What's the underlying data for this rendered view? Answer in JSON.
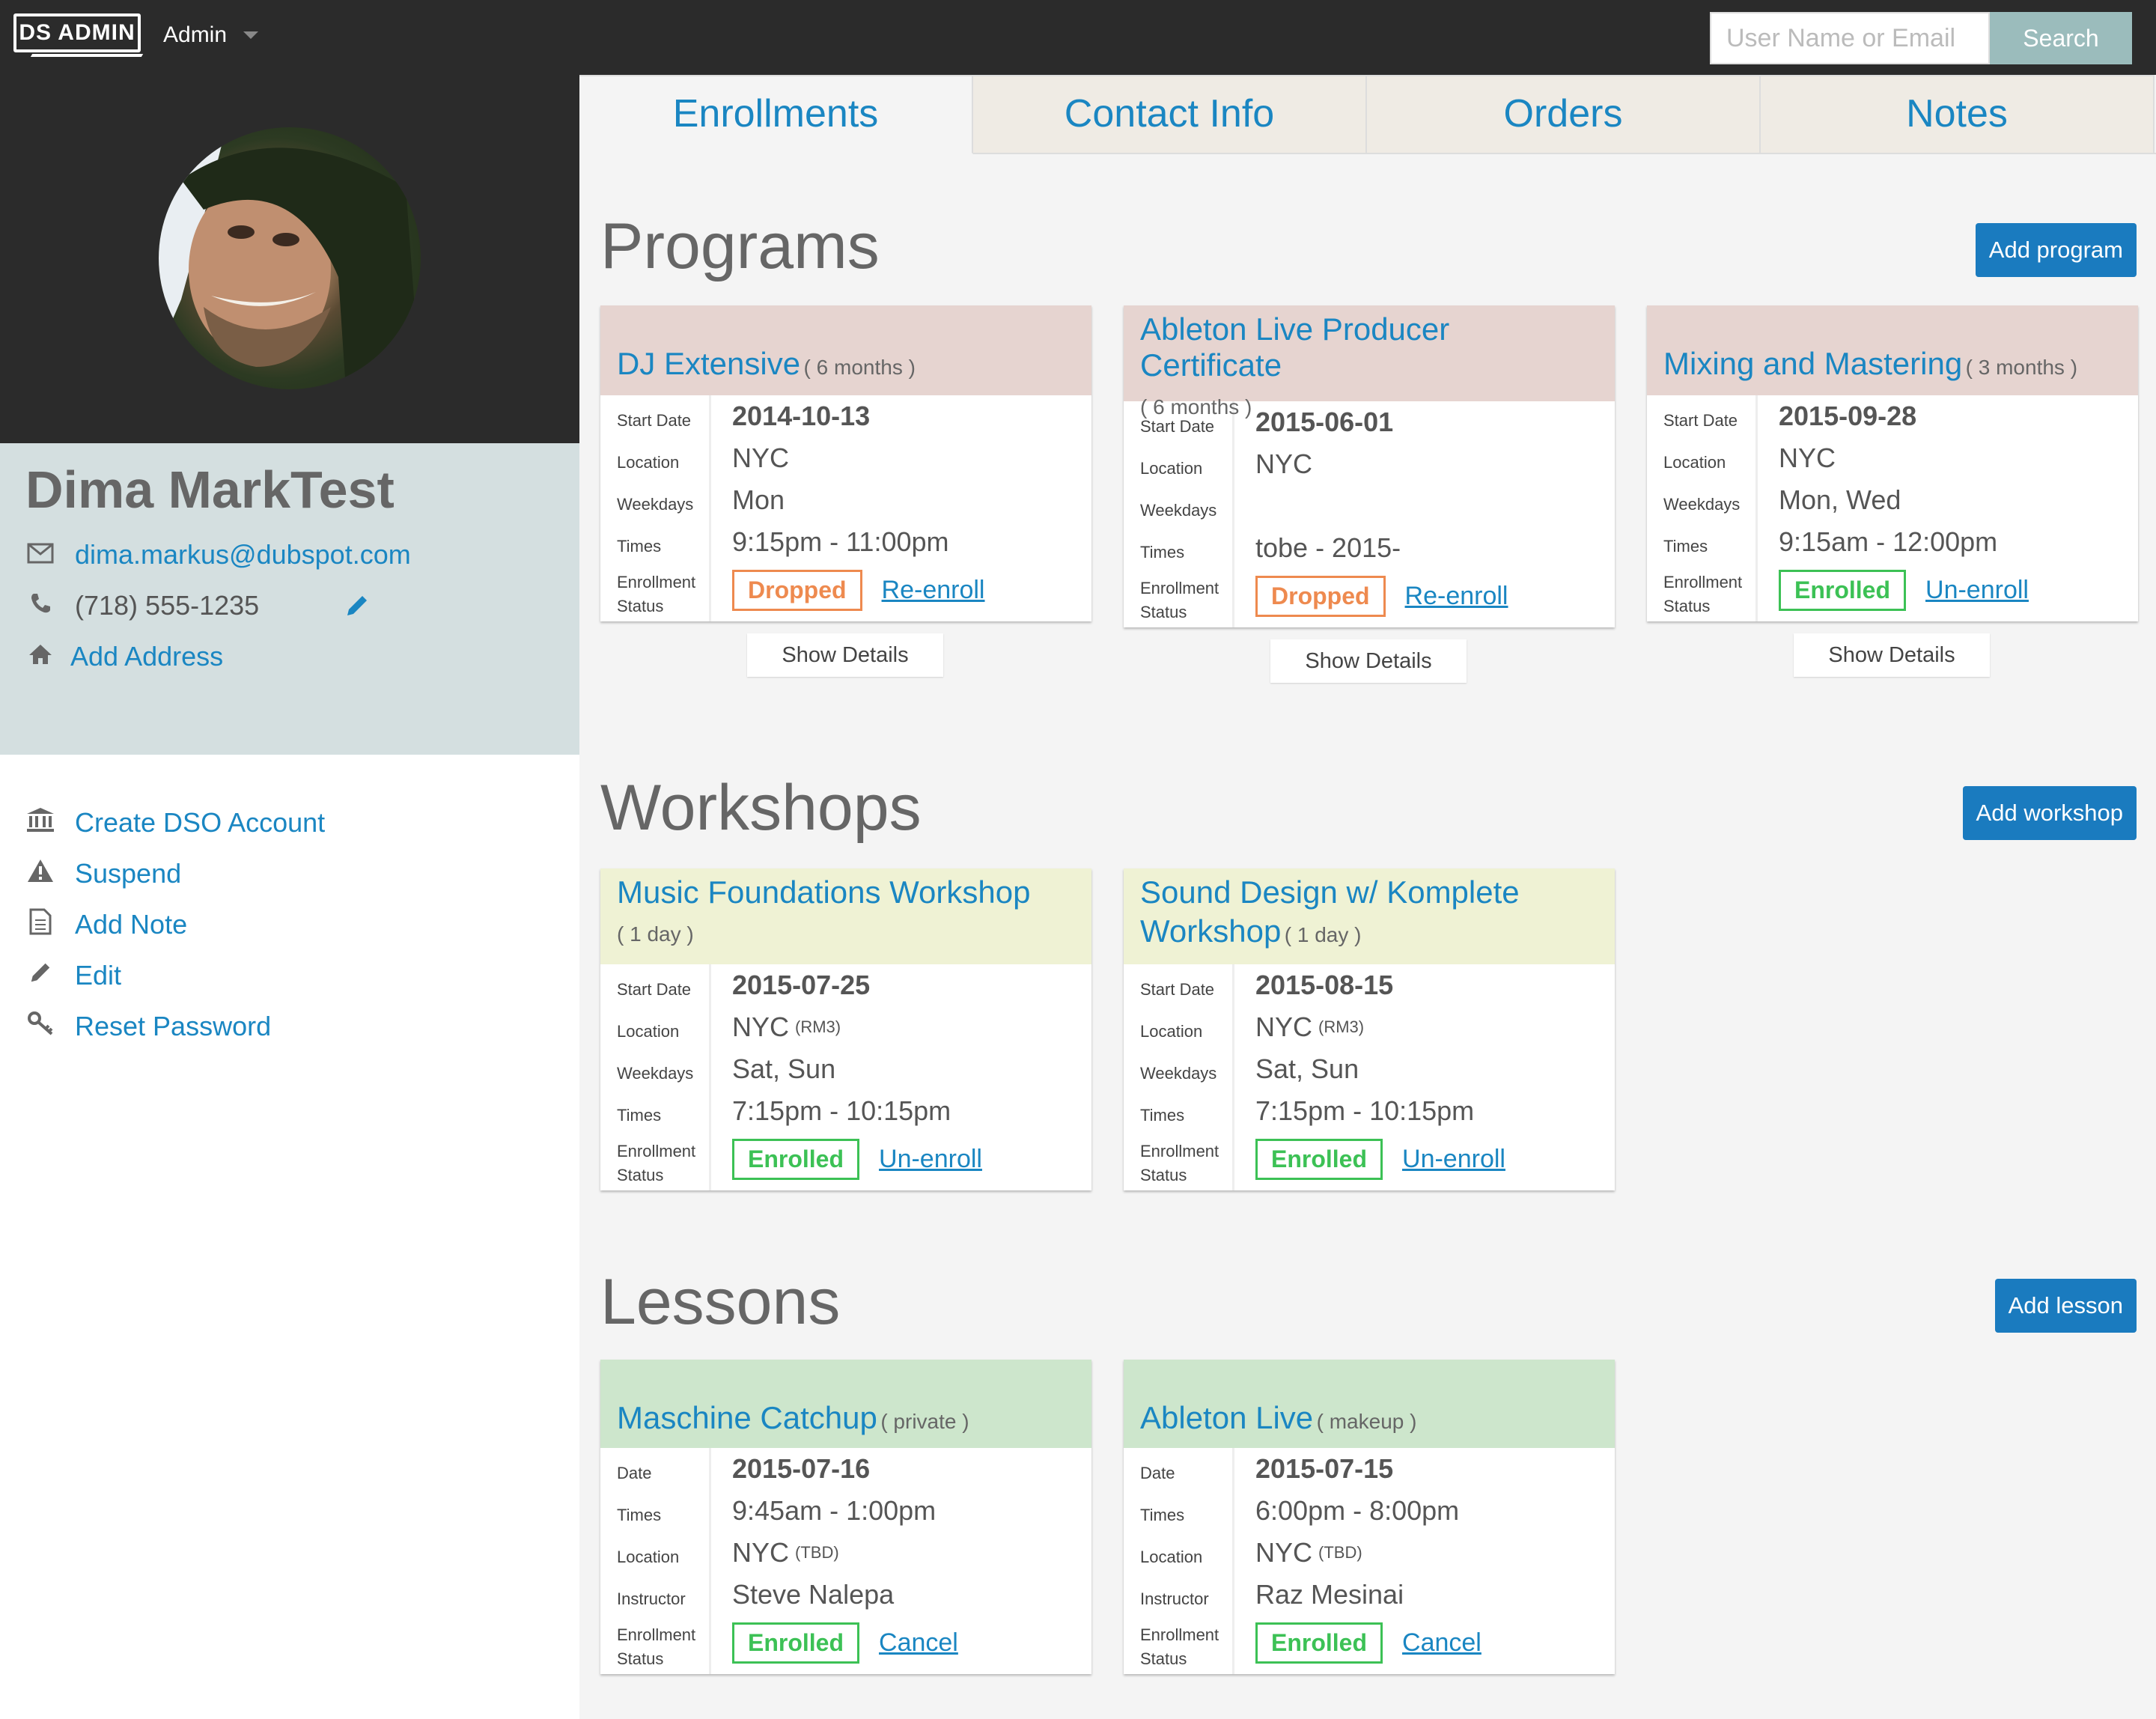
{
  "topbar": {
    "logo": "DS ADMIN",
    "admin_label": "Admin",
    "search_placeholder": "User Name or Email",
    "search_label": "Search"
  },
  "sidebar": {
    "user_name": "Dima MarkTest",
    "email": "dima.markus@dubspot.com",
    "phone": "(718) 555-1235",
    "add_address": "Add Address",
    "actions": {
      "create_dso": "Create DSO Account",
      "suspend": "Suspend",
      "add_note": "Add Note",
      "edit": "Edit",
      "reset_password": "Reset Password"
    }
  },
  "tabs": [
    "Enrollments",
    "Contact Info",
    "Orders",
    "Notes"
  ],
  "labels": {
    "start_date": "Start Date",
    "date": "Date",
    "location": "Location",
    "weekdays": "Weekdays",
    "times": "Times",
    "instructor": "Instructor",
    "enrollment": "Enrollment",
    "status": "Status",
    "show_details": "Show Details"
  },
  "programs": {
    "title": "Programs",
    "add_label": "Add program",
    "cards": [
      {
        "name": "DJ Extensive",
        "duration": "( 6 months )",
        "start_date": "2014-10-13",
        "location": "NYC",
        "weekdays": "Mon",
        "times": "9:15pm - 11:00pm",
        "status": "Dropped",
        "action": "Re-enroll"
      },
      {
        "name": "Ableton Live Producer Certificate",
        "duration": "( 6 months )",
        "start_date": "2015-06-01",
        "location": "NYC",
        "weekdays": "",
        "times": "tobe - 2015-",
        "status": "Dropped",
        "action": "Re-enroll"
      },
      {
        "name": "Mixing and Mastering",
        "duration": "( 3 months )",
        "start_date": "2015-09-28",
        "location": "NYC",
        "weekdays": "Mon, Wed",
        "times": "9:15am - 12:00pm",
        "status": "Enrolled",
        "action": "Un-enroll"
      }
    ]
  },
  "workshops": {
    "title": "Workshops",
    "add_label": "Add workshop",
    "cards": [
      {
        "name": "Music Foundations Workshop",
        "duration": "( 1 day )",
        "start_date": "2015-07-25",
        "location": "NYC",
        "room": "(RM3)",
        "weekdays": "Sat, Sun",
        "times": "7:15pm - 10:15pm",
        "status": "Enrolled",
        "action": "Un-enroll"
      },
      {
        "name_line1": "Sound Design w/ Komplete",
        "name_line2": "Workshop",
        "duration": "( 1 day )",
        "start_date": "2015-08-15",
        "location": "NYC",
        "room": "(RM3)",
        "weekdays": "Sat, Sun",
        "times": "7:15pm - 10:15pm",
        "status": "Enrolled",
        "action": "Un-enroll"
      }
    ]
  },
  "lessons": {
    "title": "Lessons",
    "add_label": "Add lesson",
    "cards": [
      {
        "name": "Maschine Catchup",
        "kind": "( private )",
        "date": "2015-07-16",
        "times": "9:45am - 1:00pm",
        "location": "NYC",
        "room": "(TBD)",
        "instructor": "Steve Nalepa",
        "status": "Enrolled",
        "action": "Cancel"
      },
      {
        "name": "Ableton Live",
        "kind": "( makeup )",
        "date": "2015-07-15",
        "times": "6:00pm - 8:00pm",
        "location": "NYC",
        "room": "(TBD)",
        "instructor": "Raz Mesinai",
        "status": "Enrolled",
        "action": "Cancel"
      }
    ]
  },
  "colors": {
    "link": "#1a86c2",
    "button": "#1a7bbf",
    "dropped": "#ee8a4f",
    "enrolled": "#3cc155",
    "program_header": "#e6d4d0",
    "workshop_header": "#eff2d4",
    "lesson_header": "#cde6cc"
  }
}
